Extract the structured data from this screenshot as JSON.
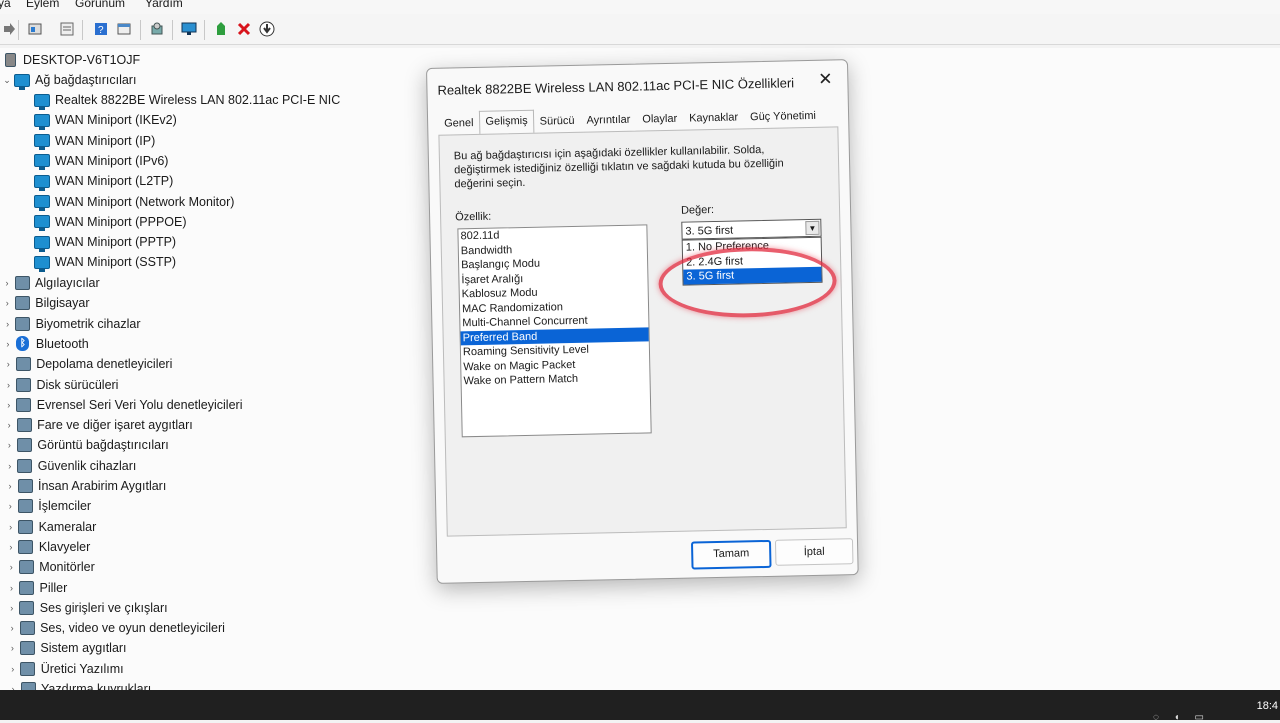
{
  "menu": [
    "ya",
    "Eylem",
    "Görünüm",
    "Yardım"
  ],
  "toolbar_icons": [
    "forward-icon",
    "properties-icon",
    "view-icon",
    "help-icon",
    "window-icon",
    "scan-hardware-icon",
    "monitor-icon",
    "add-driver-icon",
    "uninstall-icon",
    "download-icon"
  ],
  "tree": {
    "root": "DESKTOP-V6T1OJF",
    "network_category": "Ağ bağdaştırıcıları",
    "network_items": [
      "Realtek 8822BE Wireless LAN 802.11ac PCI-E NIC",
      "WAN Miniport (IKEv2)",
      "WAN Miniport (IP)",
      "WAN Miniport (IPv6)",
      "WAN Miniport (L2TP)",
      "WAN Miniport (Network Monitor)",
      "WAN Miniport (PPPOE)",
      "WAN Miniport (PPTP)",
      "WAN Miniport (SSTP)"
    ],
    "categories": [
      {
        "label": "Algılayıcılar",
        "icon": "sensor-icon"
      },
      {
        "label": "Bilgisayar",
        "icon": "computer-icon"
      },
      {
        "label": "Biyometrik cihazlar",
        "icon": "biometric-icon"
      },
      {
        "label": "Bluetooth",
        "icon": "bluetooth-icon"
      },
      {
        "label": "Depolama denetleyicileri",
        "icon": "storage-icon"
      },
      {
        "label": "Disk sürücüleri",
        "icon": "disk-icon"
      },
      {
        "label": "Evrensel Seri Veri Yolu denetleyicileri",
        "icon": "usb-icon"
      },
      {
        "label": "Fare ve diğer işaret aygıtları",
        "icon": "mouse-icon"
      },
      {
        "label": "Görüntü bağdaştırıcıları",
        "icon": "display-adapter-icon"
      },
      {
        "label": "Güvenlik cihazları",
        "icon": "security-icon"
      },
      {
        "label": "İnsan Arabirim Aygıtları",
        "icon": "hid-icon"
      },
      {
        "label": "İşlemciler",
        "icon": "processor-icon"
      },
      {
        "label": "Kameralar",
        "icon": "camera-icon"
      },
      {
        "label": "Klavyeler",
        "icon": "keyboard-icon"
      },
      {
        "label": "Monitörler",
        "icon": "monitor-icon"
      },
      {
        "label": "Piller",
        "icon": "battery-icon"
      },
      {
        "label": "Ses girişleri ve çıkışları",
        "icon": "audio-io-icon"
      },
      {
        "label": "Ses, video ve oyun denetleyicileri",
        "icon": "sound-icon"
      },
      {
        "label": "Sistem aygıtları",
        "icon": "system-icon"
      },
      {
        "label": "Üretici Yazılımı",
        "icon": "firmware-icon"
      },
      {
        "label": "Yazdırma kuyrukları",
        "icon": "printer-icon"
      }
    ]
  },
  "dialog": {
    "title": "Realtek 8822BE Wireless LAN 802.11ac PCI-E NIC Özellikleri",
    "tabs": [
      "Genel",
      "Gelişmiş",
      "Sürücü",
      "Ayrıntılar",
      "Olaylar",
      "Kaynaklar",
      "Güç Yönetimi"
    ],
    "active_tab": "Gelişmiş",
    "description": "Bu ağ bağdaştırıcısı için aşağıdaki özellikler kullanılabilir. Solda, değiştirmek istediğiniz özelliği tıklatın ve sağdaki kutuda bu özelliğin değerini seçin.",
    "property_label": "Özellik:",
    "value_label": "Değer:",
    "properties": [
      "802.11d",
      "Bandwidth",
      "Başlangıç Modu",
      "İşaret Aralığı",
      "Kablosuz Modu",
      "MAC Randomization",
      "Multi-Channel Concurrent",
      "Preferred Band",
      "Roaming Sensitivity Level",
      "Wake on Magic Packet",
      "Wake on Pattern Match"
    ],
    "selected_property": "Preferred Band",
    "value_selected": "3. 5G first",
    "value_options": [
      "1. No Preference",
      "2. 2.4G first",
      "3. 5G first"
    ],
    "ok_label": "Tamam",
    "cancel_label": "İptal",
    "highlight_color": "#e0283c"
  },
  "taskbar": {
    "clock": "18:4"
  }
}
